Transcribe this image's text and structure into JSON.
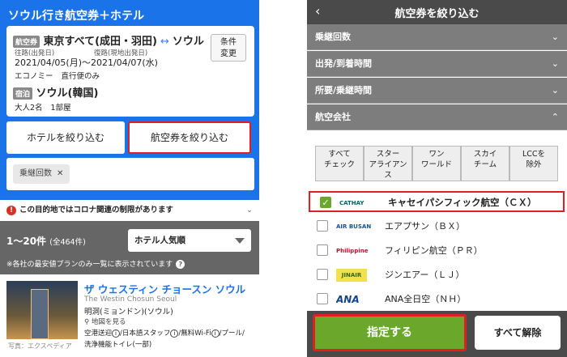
{
  "left": {
    "title": "ソウル行き航空券＋ホテル",
    "summary": {
      "air_tag": "航空券",
      "origin": "東京すべて(成田・羽田)",
      "destination": "ソウル",
      "out_label": "往路(出発日)",
      "ret_label": "復路(現地出発日)",
      "dates": "2021/04/05(月)〜2021/04/07(水)",
      "cabin": "エコノミー",
      "direct": "直行便のみ",
      "hotel_tag": "宿泊",
      "city": "ソウル(韓国)",
      "adults": "大人2名",
      "rooms": "1部屋",
      "change_label_1": "条件",
      "change_label_2": "変更"
    },
    "filter_hotel": "ホテルを絞り込む",
    "filter_air": "航空券を絞り込む",
    "chip": "乗継回数",
    "notice": "この目的地ではコロナ関連の制限があります",
    "count": "1〜20件",
    "count_total": "(全464件)",
    "sort": "ホテル人気順",
    "note": "※各社の最安値プランのみ一覧に表示されています",
    "hotel": {
      "name": "ザ ウェスティン チョースン ソウル",
      "name_en": "The Westin Chosun Seoul",
      "area": "明洞(ミョンドン)(ソウル)",
      "map": "地図を見る",
      "features_1": "空港送迎",
      "features_2": "日本語スタッフ",
      "features_3": "無料Wi-Fi",
      "features_4": "プール",
      "features_5": "洗浄機能トイレ(一部)",
      "photo_credit": "写真：エクスペディア"
    }
  },
  "right": {
    "title": "航空券を絞り込む",
    "sections": [
      "乗継回数",
      "出発/到着時間",
      "所要/乗継時間",
      "航空会社"
    ],
    "quick_filters": [
      [
        "すべて",
        "チェック"
      ],
      [
        "スター",
        "アライアン",
        "ス"
      ],
      [
        "ワン",
        "ワールド"
      ],
      [
        "スカイ",
        "チーム"
      ],
      [
        "LCCを",
        "除外"
      ]
    ],
    "airlines": [
      {
        "logo": "CATHAY PACIFIC",
        "name": "キャセイパシフィック航空（ＣＸ）",
        "checked": true,
        "color": "#006564"
      },
      {
        "logo": "AIR BUSAN",
        "name": "エアプサン（ＢＸ）",
        "checked": false,
        "color": "#1a4fa0"
      },
      {
        "logo": "Philippine Airlines",
        "name": "フィリピン航空（ＰＲ）",
        "checked": false,
        "color": "#c8102e"
      },
      {
        "logo": "JINAIR",
        "name": "ジンエアー（ＬＪ）",
        "checked": false,
        "color": "#2a6a1a"
      },
      {
        "logo": "ANA",
        "name": "ANA全日空（ＮＨ）",
        "checked": false,
        "color": "#13448f"
      }
    ],
    "apply": "指定する",
    "clear": "すべて解除"
  }
}
